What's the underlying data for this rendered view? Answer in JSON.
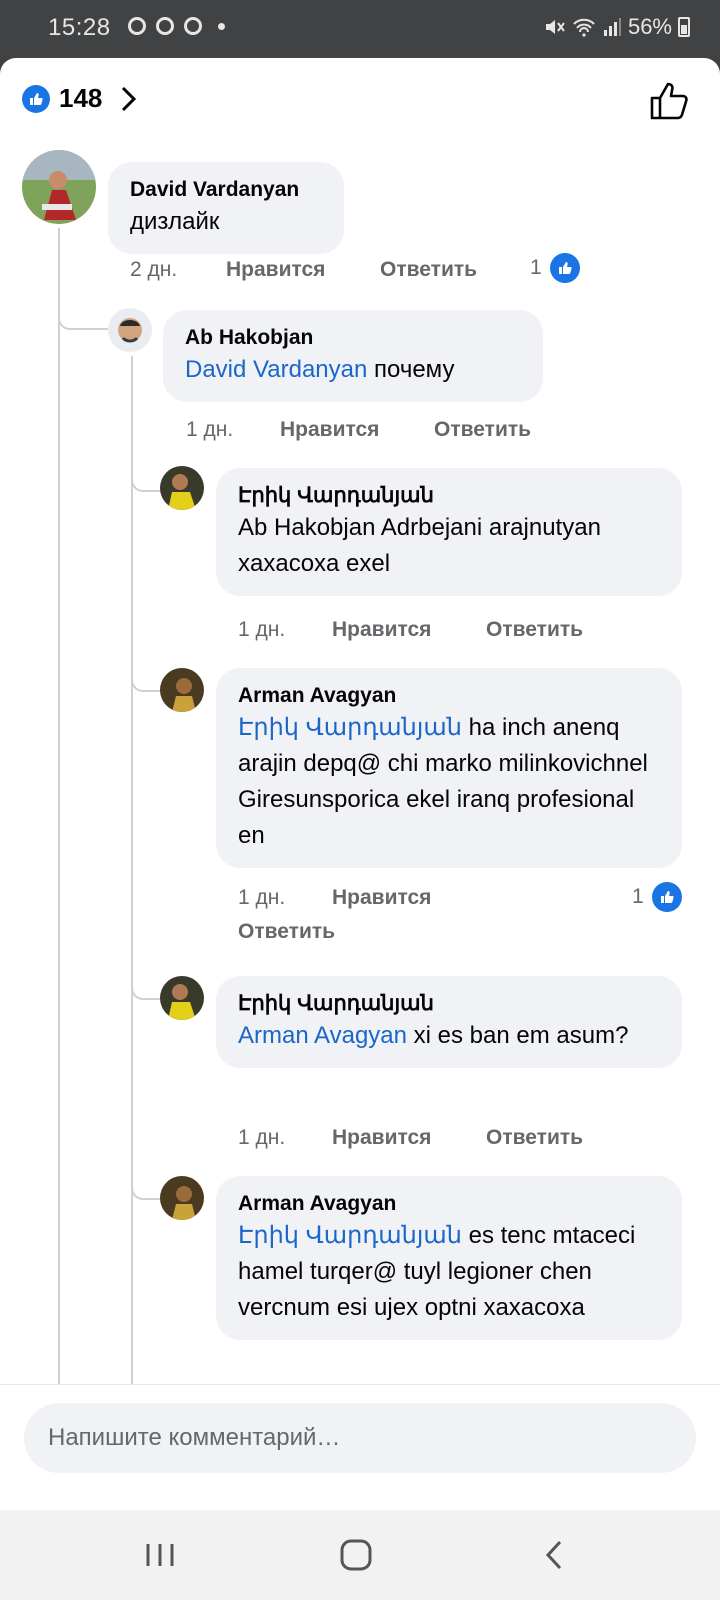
{
  "status_bar": {
    "time": "15:28",
    "battery": "56%"
  },
  "reactions": {
    "count": "148"
  },
  "comments": [
    {
      "author": "David Vardanyan",
      "mention": "",
      "text": "дизлайк",
      "age": "2 дн.",
      "like": "Нравится",
      "reply": "Ответить",
      "reaction_count": "1"
    },
    {
      "author": "Ab Hakobjan",
      "mention": "David Vardanyan",
      "text": " почему",
      "age": "1 дн.",
      "like": "Нравится",
      "reply": "Ответить",
      "reaction_count": ""
    },
    {
      "author": "Էրիկ Վարդանյան",
      "mention": "",
      "text": "Ab Hakobjan Adrbejani arajnutyan xaxacoxa exel",
      "age": "1 дн.",
      "like": "Нравится",
      "reply": "Ответить",
      "reaction_count": ""
    },
    {
      "author": "Arman Avagyan",
      "mention": "Էրիկ Վարդանյան",
      "text": " ha inch anenq arajin depq@ chi marko milinkovichnel Giresunsporica ekel iranq profesional en",
      "age": "1 дн.",
      "like": "Нравится",
      "reply": "Ответить",
      "reaction_count": "1"
    },
    {
      "author": "Էրիկ Վարդանյան",
      "mention": "Arman Avagyan",
      "text": " xi es ban em asum?",
      "age": "1 дн.",
      "like": "Нравится",
      "reply": "Ответить",
      "reaction_count": ""
    },
    {
      "author": "Arman Avagyan",
      "mention": "Էրիկ Վարդանյան",
      "text": " es tenc mtaceci hamel turqer@ tuyl legioner chen vercnum esi ujex optni xaxacoxa",
      "age": "",
      "like": "",
      "reply": "",
      "reaction_count": ""
    }
  ],
  "composer": {
    "placeholder": "Напишите комментарий…"
  },
  "icons": {
    "status": [
      "signal-app-icon",
      "chrome-icon",
      "messenger-icon",
      "mute-icon",
      "wifi-icon",
      "cell-signal-icon",
      "battery-icon"
    ],
    "nav": [
      "recents-icon",
      "home-icon",
      "back-icon"
    ],
    "like": "thumbs-up-icon"
  },
  "colors": {
    "accent": "#1b74e4",
    "mention": "#1b66c9",
    "bubble": "#f0f2f5"
  }
}
